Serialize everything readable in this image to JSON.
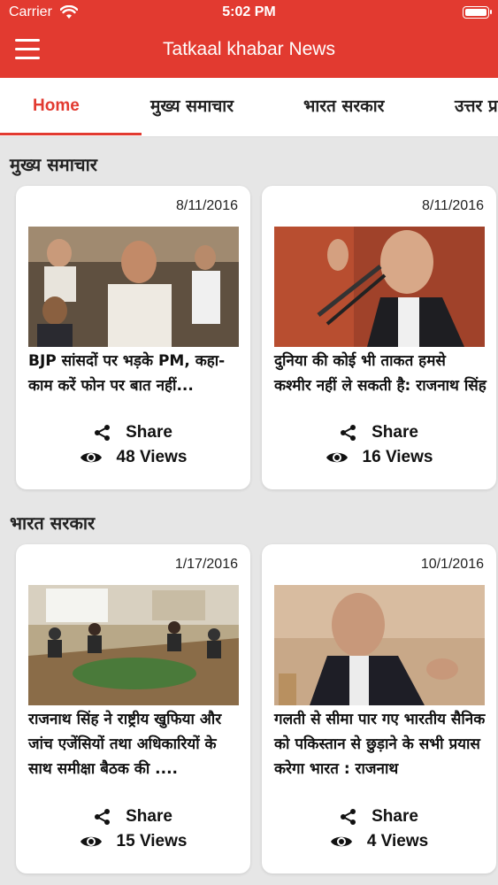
{
  "status_bar": {
    "carrier": "Carrier",
    "time": "5:02 PM"
  },
  "header": {
    "title": "Tatkaal khabar News",
    "menu_icon": "hamburger-menu-icon"
  },
  "tabs": [
    {
      "label": "Home",
      "active": true
    },
    {
      "label": "मुख्य समाचार",
      "active": false
    },
    {
      "label": "भारत सरकार",
      "active": false
    },
    {
      "label": "उत्तर प्र",
      "active": false
    }
  ],
  "colors": {
    "accent": "#e23a30",
    "background": "#e6e6e6",
    "card": "#ffffff"
  },
  "sections": [
    {
      "title": "मुख्य समाचार",
      "cards": [
        {
          "date": "8/11/2016",
          "headline": "BJP सांसदों पर भड़के PM, कहा- काम करें फोन पर बात नहीं...",
          "share_label": "Share",
          "views_label": "48 Views"
        },
        {
          "date": "8/11/2016",
          "headline": "दुनिया की कोई भी ताकत हमसे कश्मीर नहीं ले सकती है: राजनाथ सिंह",
          "share_label": "Share",
          "views_label": "16 Views"
        }
      ]
    },
    {
      "title": "भारत सरकार",
      "cards": [
        {
          "date": "1/17/2016",
          "headline": "राजनाथ सिंह ने राष्ट्रीय खुफिया और जांच एजेंसियों तथा अधिकारियों के साथ समीक्षा बैठक की ....",
          "share_label": "Share",
          "views_label": "15 Views"
        },
        {
          "date": "10/1/2016",
          "headline": "गलती से सीमा पार गए भारतीय सैनिक को पकिस्तान से छुड़ाने के सभी प्रयास करेगा भारत : राजनाथ",
          "share_label": "Share",
          "views_label": "4 Views"
        }
      ]
    }
  ]
}
